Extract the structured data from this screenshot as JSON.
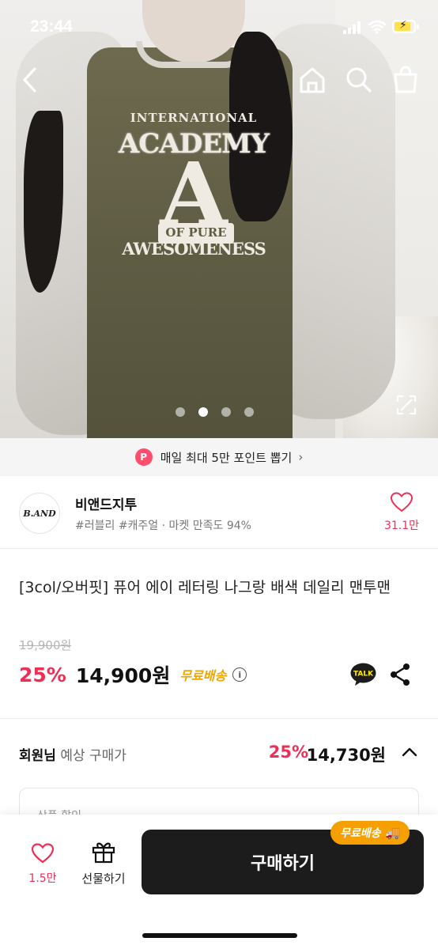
{
  "status_bar": {
    "time": "23:44"
  },
  "hero": {
    "print_line1": "INTERNATIONAL",
    "print_line2": "ACADEMY",
    "print_letter": "A",
    "print_band": "OF PURE",
    "print_line4": "AWESOMENESS",
    "image_index": 2,
    "image_count": 4
  },
  "promo": {
    "badge": "P",
    "text": "매일 최대 5만 포인트 뽑기",
    "chevron": "›"
  },
  "store": {
    "logo_text": "B.AND",
    "name": "비앤드지투",
    "tags": "#러블리 #캐주얼 · 마켓 만족도 94%",
    "likes": "31.1만"
  },
  "product": {
    "title": "[3col/오버핏] 퓨어 에이 레터링 나그랑 배색 데일리 맨투맨",
    "original_price": "19,900원",
    "discount": "25%",
    "price": "14,900원",
    "shipping": "무료배송",
    "info_icon": "i",
    "talk_label": "TALK"
  },
  "member_price": {
    "label_bold": "회원님",
    "label_rest": " 예상 구매가",
    "discount": "25%",
    "price": "14,730원"
  },
  "coupon_card": {
    "title": "상품 할인"
  },
  "bottom_bar": {
    "likes": "1.5만",
    "gift_label": "선물하기",
    "buy_label": "구매하기",
    "free_shipping_badge": "무료배송"
  },
  "colors": {
    "accent_pink": "#ee2f55",
    "shipping_orange": "#f0a500",
    "buy_button": "#1c1c1c"
  }
}
